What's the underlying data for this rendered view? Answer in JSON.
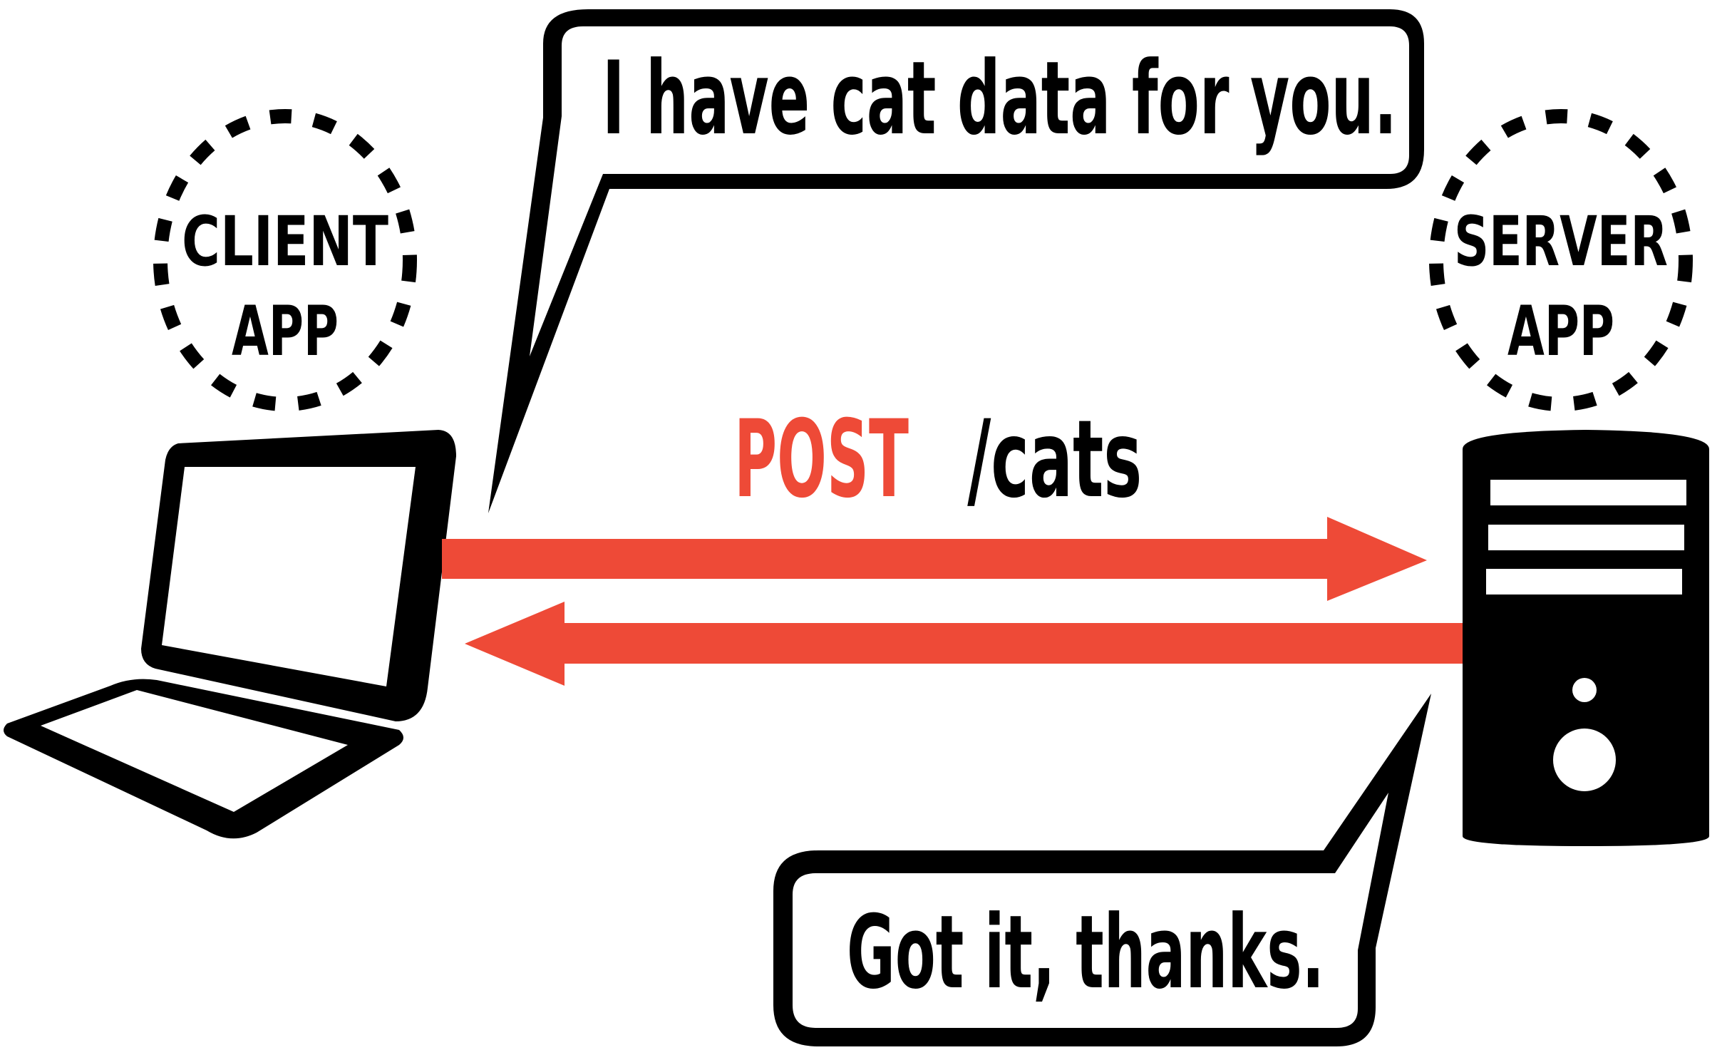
{
  "client": {
    "label_line1": "CLIENT",
    "label_line2": "APP"
  },
  "server": {
    "label_line1": "SERVER",
    "label_line2": "APP"
  },
  "request": {
    "method": "POST",
    "path": "/cats"
  },
  "bubbles": {
    "client_message": "I have cat data for you.",
    "server_message": "Got it, thanks."
  },
  "colors": {
    "accent": "#EE4A37",
    "ink": "#000000",
    "background": "#FFFFFF"
  }
}
